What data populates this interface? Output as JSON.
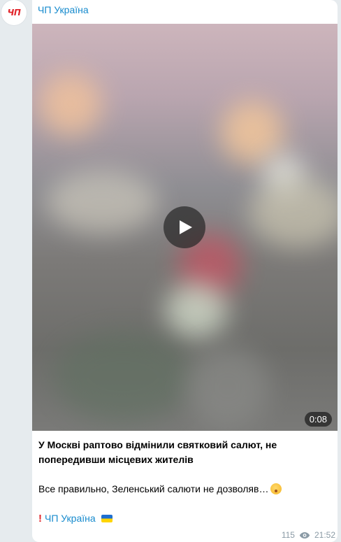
{
  "channel": {
    "avatar_text": "ЧП",
    "name": "ЧП Україна"
  },
  "video": {
    "duration": "0:08",
    "play_icon": "play-icon"
  },
  "post": {
    "headline": "У Москві раптово відмінили святковий салют, не попередивши місцевих жителів",
    "body": "Все правильно, Зеленський салюти не дозволяв…",
    "body_emoji": "shushing-face-emoji",
    "signature_prefix_icon": "exclamation-icon",
    "signature": "ЧП Україна",
    "signature_flag": "ukraine-flag-emoji"
  },
  "meta": {
    "views": "115",
    "views_icon": "eye-icon",
    "time": "21:52"
  },
  "colors": {
    "link": "#168acd",
    "background": "#e6ebee",
    "meta": "#8a9aa5"
  }
}
